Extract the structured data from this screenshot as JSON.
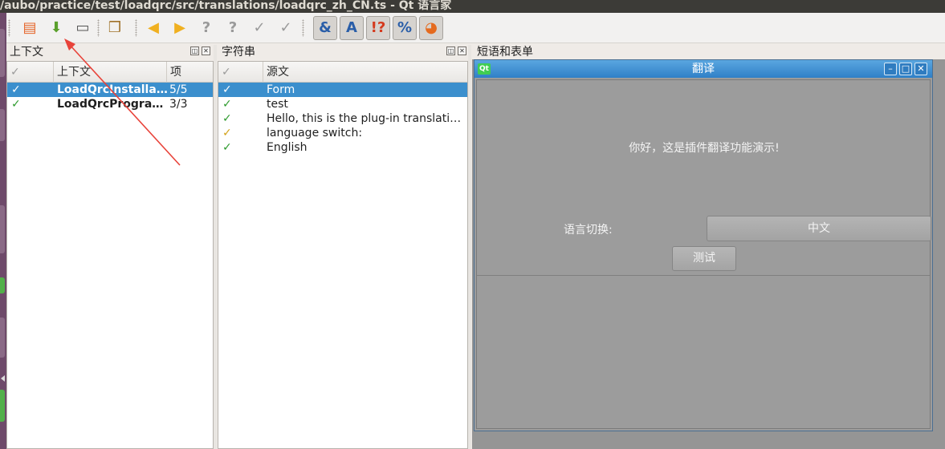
{
  "window": {
    "title": "/aubo/practice/test/loadqrc/src/translations/loadqrc_zh_CN.ts - Qt 语言家"
  },
  "toolbar": {
    "buttons": [
      {
        "name": "open-icon",
        "glyph": "📂",
        "color": "#e5662b"
      },
      {
        "name": "save-icon",
        "glyph": "⬇",
        "color": "#5aa02c"
      },
      {
        "name": "print-icon",
        "glyph": "🖶",
        "color": "#555555"
      },
      {
        "name": "phrasebook-icon",
        "glyph": "📖",
        "color": "#a0722a"
      },
      {
        "name": "prev-icon",
        "glyph": "◀",
        "color": "#f0b020"
      },
      {
        "name": "next-icon",
        "glyph": "▶",
        "color": "#f0b020"
      },
      {
        "name": "prev-unfinished-icon",
        "glyph": "?",
        "color": "#9a9a9a"
      },
      {
        "name": "next-unfinished-icon",
        "glyph": "?",
        "color": "#9a9a9a"
      },
      {
        "name": "done-icon",
        "glyph": "✓",
        "color": "#9a9a9a"
      },
      {
        "name": "done-and-next-icon",
        "glyph": "✓",
        "color": "#9a9a9a"
      },
      {
        "name": "accelerators-icon",
        "glyph": "&",
        "color": "#2a5ea8"
      },
      {
        "name": "ending-punctuation-icon",
        "glyph": "A",
        "color": "#2a5ea8"
      },
      {
        "name": "phrase-matches-icon",
        "glyph": "!?",
        "color": "#d43a1e"
      },
      {
        "name": "place-markers-icon",
        "glyph": "%",
        "color": "#2a5ea8"
      },
      {
        "name": "languages-icon",
        "glyph": "◕",
        "color": "#e56a1e"
      }
    ]
  },
  "context_panel": {
    "title": "上下文",
    "headers": {
      "col2": "上下文",
      "col3": "项"
    },
    "rows": [
      {
        "name": "LoadQrcInstallati…",
        "count": "5/5",
        "selected": true
      },
      {
        "name": "LoadQrcProgram…",
        "count": "3/3",
        "selected": false
      }
    ]
  },
  "strings_panel": {
    "title": "字符串",
    "headers": {
      "col2": "源文"
    },
    "rows": [
      {
        "text": "Form",
        "selected": true,
        "state": "done"
      },
      {
        "text": "test",
        "selected": false,
        "state": "done"
      },
      {
        "text": "Hello, this is the plug-in translatio…",
        "selected": false,
        "state": "done"
      },
      {
        "text": "language switch:",
        "selected": false,
        "state": "warn"
      },
      {
        "text": "English",
        "selected": false,
        "state": "done"
      }
    ]
  },
  "phrases_panel": {
    "title": "短语和表单"
  },
  "form_preview": {
    "title": "翻译",
    "logo": "Qt",
    "hello_text": "你好，这是插件翻译功能演示!",
    "lang_label": "语言切换:",
    "combo_value": "中文",
    "test_button": "测试"
  },
  "colors": {
    "selection": "#3b8fcd",
    "check": "#2e9b2e",
    "warn": "#d3a21a",
    "annotation": "#e8433a"
  }
}
